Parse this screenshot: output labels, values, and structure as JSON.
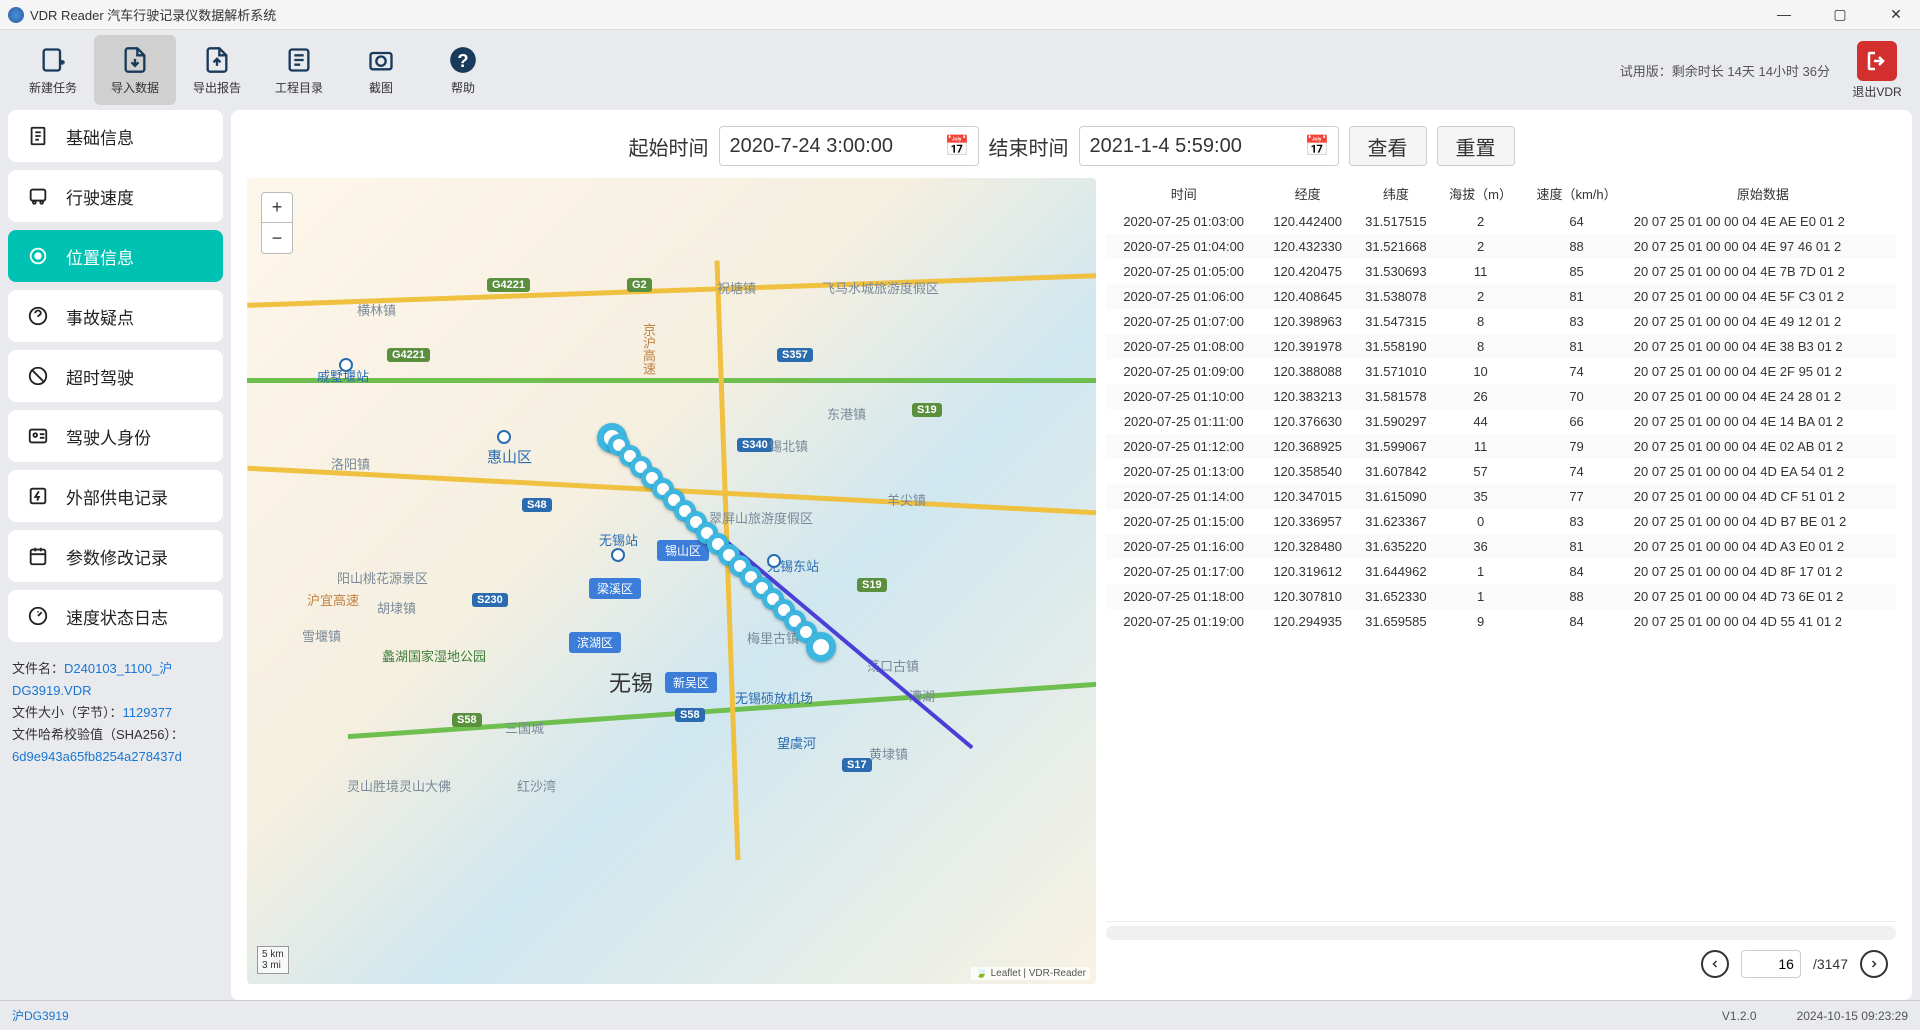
{
  "titlebar": {
    "title": "VDR Reader 汽车行驶记录仪数据解析系统"
  },
  "toolbar": {
    "items": [
      {
        "label": "新建任务"
      },
      {
        "label": "导入数据"
      },
      {
        "label": "导出报告"
      },
      {
        "label": "工程目录"
      },
      {
        "label": "截图"
      },
      {
        "label": "帮助"
      }
    ],
    "trial": "试用版：剩余时长 14天 14小时 36分",
    "exit": "退出VDR"
  },
  "sidebar": {
    "items": [
      {
        "label": "基础信息"
      },
      {
        "label": "行驶速度"
      },
      {
        "label": "位置信息"
      },
      {
        "label": "事故疑点"
      },
      {
        "label": "超时驾驶"
      },
      {
        "label": "驾驶人身份"
      },
      {
        "label": "外部供电记录"
      },
      {
        "label": "参数修改记录"
      },
      {
        "label": "速度状态日志"
      }
    ],
    "file": {
      "name_label": "文件名：",
      "name_value": "D240103_1100_沪DG3919.VDR",
      "size_label": "文件大小（字节）：",
      "size_value": "1129377",
      "hash_label": "文件哈希校验值（SHA256）：",
      "hash_value": "6d9e943a65fb8254a278437d"
    }
  },
  "time": {
    "start_label": "起始时间",
    "start_value": "2020-7-24 3:00:00",
    "end_label": "结束时间",
    "end_value": "2021-1-4 5:59:00",
    "view_btn": "查看",
    "reset_btn": "重置"
  },
  "map": {
    "scale_km": "5 km",
    "scale_mi": "3 mi",
    "attribution": "Leaflet | VDR-Reader",
    "labels": {
      "wuxi": "无锡",
      "henglin": "横林镇",
      "zhucun": "祝塘镇",
      "feima": "飞马水城旅游度假区",
      "dongang": "东港镇",
      "yangjian": "羊尖镇",
      "cuiping": "翠屏山旅游度假区",
      "xibei": "锡北镇",
      "luoyang": "洛阳镇",
      "huishan": "惠山区",
      "yangshan": "阳山桃花源景区",
      "hushang": "胡埭镇",
      "xuetang": "雪堰镇",
      "lihu": "蠡湖国家湿地公园",
      "sanguo": "三国城",
      "hongsha": "红沙湾",
      "lingshan": "灵山胜境灵山大佛",
      "wuxizhan": "无锡站",
      "liangxi": "梁溪区",
      "binhu": "滨湖区",
      "xishan": "锡山区",
      "xinwu": "新吴区",
      "wuxidong": "无锡东站",
      "wuxishuo": "无锡硕放机场",
      "meili": "梅里古镇",
      "wanghu": "望虞河",
      "dangkou": "荡口古镇",
      "huangdai": "黄埭镇",
      "caohu": "漕湖",
      "weidian": "戚墅堰站",
      "huyi": "沪宜高速",
      "jinghu": "京沪高速"
    }
  },
  "table": {
    "headers": {
      "time": "时间",
      "lon": "经度",
      "lat": "纬度",
      "alt": "海拔（m）",
      "speed": "速度（km/h）",
      "raw": "原始数据"
    },
    "rows": [
      {
        "t": "2020-07-25 01:03:00",
        "lon": "120.442400",
        "lat": "31.517515",
        "alt": "2",
        "spd": "64",
        "raw": "20 07 25 01 00 00 04 4E AE E0 01 2"
      },
      {
        "t": "2020-07-25 01:04:00",
        "lon": "120.432330",
        "lat": "31.521668",
        "alt": "2",
        "spd": "88",
        "raw": "20 07 25 01 00 00 04 4E 97 46 01 2"
      },
      {
        "t": "2020-07-25 01:05:00",
        "lon": "120.420475",
        "lat": "31.530693",
        "alt": "11",
        "spd": "85",
        "raw": "20 07 25 01 00 00 04 4E 7B 7D 01 2"
      },
      {
        "t": "2020-07-25 01:06:00",
        "lon": "120.408645",
        "lat": "31.538078",
        "alt": "2",
        "spd": "81",
        "raw": "20 07 25 01 00 00 04 4E 5F C3 01 2"
      },
      {
        "t": "2020-07-25 01:07:00",
        "lon": "120.398963",
        "lat": "31.547315",
        "alt": "8",
        "spd": "83",
        "raw": "20 07 25 01 00 00 04 4E 49 12 01 2"
      },
      {
        "t": "2020-07-25 01:08:00",
        "lon": "120.391978",
        "lat": "31.558190",
        "alt": "8",
        "spd": "81",
        "raw": "20 07 25 01 00 00 04 4E 38 B3 01 2"
      },
      {
        "t": "2020-07-25 01:09:00",
        "lon": "120.388088",
        "lat": "31.571010",
        "alt": "10",
        "spd": "74",
        "raw": "20 07 25 01 00 00 04 4E 2F 95 01 2"
      },
      {
        "t": "2020-07-25 01:10:00",
        "lon": "120.383213",
        "lat": "31.581578",
        "alt": "26",
        "spd": "70",
        "raw": "20 07 25 01 00 00 04 4E 24 28 01 2"
      },
      {
        "t": "2020-07-25 01:11:00",
        "lon": "120.376630",
        "lat": "31.590297",
        "alt": "44",
        "spd": "66",
        "raw": "20 07 25 01 00 00 04 4E 14 BA 01 2"
      },
      {
        "t": "2020-07-25 01:12:00",
        "lon": "120.368925",
        "lat": "31.599067",
        "alt": "11",
        "spd": "79",
        "raw": "20 07 25 01 00 00 04 4E 02 AB 01 2"
      },
      {
        "t": "2020-07-25 01:13:00",
        "lon": "120.358540",
        "lat": "31.607842",
        "alt": "57",
        "spd": "74",
        "raw": "20 07 25 01 00 00 04 4D EA 54 01 2"
      },
      {
        "t": "2020-07-25 01:14:00",
        "lon": "120.347015",
        "lat": "31.615090",
        "alt": "35",
        "spd": "77",
        "raw": "20 07 25 01 00 00 04 4D CF 51 01 2"
      },
      {
        "t": "2020-07-25 01:15:00",
        "lon": "120.336957",
        "lat": "31.623367",
        "alt": "0",
        "spd": "83",
        "raw": "20 07 25 01 00 00 04 4D B7 BE 01 2"
      },
      {
        "t": "2020-07-25 01:16:00",
        "lon": "120.328480",
        "lat": "31.635220",
        "alt": "36",
        "spd": "81",
        "raw": "20 07 25 01 00 00 04 4D A3 E0 01 2"
      },
      {
        "t": "2020-07-25 01:17:00",
        "lon": "120.319612",
        "lat": "31.644962",
        "alt": "1",
        "spd": "84",
        "raw": "20 07 25 01 00 00 04 4D 8F 17 01 2"
      },
      {
        "t": "2020-07-25 01:18:00",
        "lon": "120.307810",
        "lat": "31.652330",
        "alt": "1",
        "spd": "88",
        "raw": "20 07 25 01 00 00 04 4D 73 6E 01 2"
      },
      {
        "t": "2020-07-25 01:19:00",
        "lon": "120.294935",
        "lat": "31.659585",
        "alt": "9",
        "spd": "84",
        "raw": "20 07 25 01 00 00 04 4D 55 41 01 2"
      }
    ]
  },
  "pager": {
    "current": "16",
    "total": "/3147"
  },
  "status": {
    "plate": "沪DG3919",
    "version": "V1.2.0",
    "datetime": "2024-10-15 09:23:29"
  }
}
